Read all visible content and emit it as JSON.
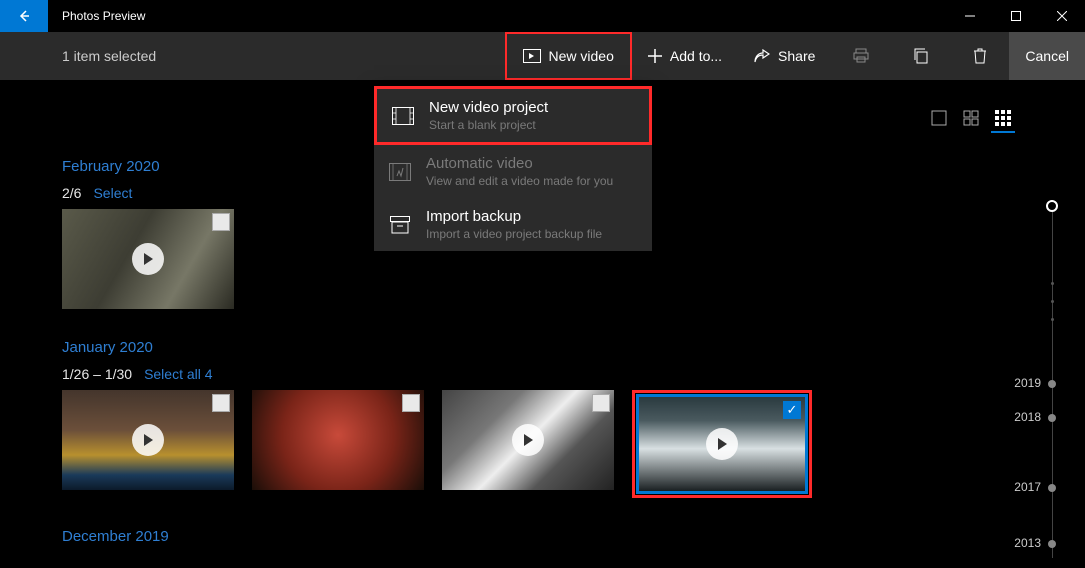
{
  "window": {
    "title": "Photos Preview"
  },
  "toolbar": {
    "selected_text": "1 item selected",
    "new_video": "New video",
    "add_to": "Add to...",
    "share": "Share",
    "cancel": "Cancel"
  },
  "dropdown": {
    "items": [
      {
        "title": "New video project",
        "sub": "Start a blank project"
      },
      {
        "title": "Automatic video",
        "sub": "View and edit a video made for you"
      },
      {
        "title": "Import backup",
        "sub": "Import a video project backup file"
      }
    ]
  },
  "sections": {
    "feb": {
      "label": "February 2020",
      "meta": "2/6",
      "select": "Select"
    },
    "jan": {
      "label": "January 2020",
      "meta": "1/26 – 1/30",
      "select": "Select all 4"
    },
    "dec": {
      "label": "December 2019"
    }
  },
  "timeline": {
    "years": [
      "2019",
      "2018",
      "2017",
      "2013"
    ]
  }
}
